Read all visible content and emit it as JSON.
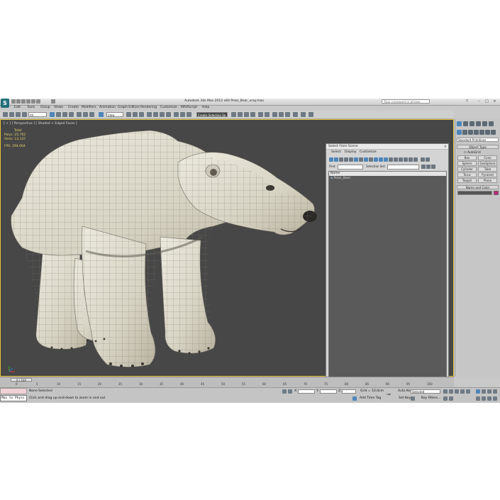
{
  "window": {
    "title": "Autodesk 3ds Max 2012 x64     Polar_Bear_vray.max",
    "search_placeholder": "Type a keyword or phrase",
    "logo_letter": "S"
  },
  "menubar": [
    "Edit",
    "Tools",
    "Group",
    "Views",
    "Create",
    "Modifiers",
    "Animation",
    "Graph Editors",
    "Rendering",
    "Customize",
    "MAXScript",
    "Help"
  ],
  "toolbar": {
    "filter_value": "All",
    "view_value": "View",
    "selection_set_placeholder": "Create Selection Se",
    "accent_color": "#4f86b9"
  },
  "viewport": {
    "label": "[ + ] [ Perspective ] [ Shaded + Edged Faces ]",
    "stats": {
      "header": "Total",
      "polys_label": "Polys:",
      "polys_value": "25,762",
      "verts_label": "Verts:",
      "verts_value": "13,137",
      "fps_label": "FPS:",
      "fps_value": "294.064"
    },
    "border_color": "#e2c437",
    "background": "#474747"
  },
  "select_dialog": {
    "title": "Select From Scene",
    "tabs": [
      "Select",
      "Display",
      "Customize"
    ],
    "find_label": "Find:",
    "selection_set_label": "Selection Set:",
    "column_header": "Name",
    "items": [
      "Polar_Bear"
    ],
    "ok_label": "OK",
    "cancel_label": "Cancel"
  },
  "command_panel": {
    "category": "Standard Primitives",
    "object_type_title": "Object Type",
    "autogrid_label": "AutoGrid",
    "primitives": [
      "Box",
      "Cone",
      "Sphere",
      "GeoSphere",
      "Cylinder",
      "Tube",
      "Torus",
      "Pyramid",
      "Teapot",
      "Plane"
    ],
    "name_color_title": "Name and Color",
    "object_color": "#c8237c"
  },
  "timeline": {
    "frame_counter": "0 / 100",
    "tick_labels": [
      "0",
      "5",
      "10",
      "15",
      "20",
      "25",
      "30",
      "35",
      "40",
      "45",
      "50",
      "55",
      "60",
      "65",
      "70",
      "75",
      "80",
      "85",
      "90",
      "95",
      "100"
    ]
  },
  "statusbar": {
    "maxscript_text": "Max to Physc",
    "selection_status": "None Selected",
    "prompt": "Click and drag up-and-down to zoom in and out",
    "x_label": "X:",
    "y_label": "Y:",
    "z_label": "Z:",
    "grid_label": "Grid = 10,0cm",
    "add_time_tag": "Add Time Tag",
    "auto_key": "Auto Key",
    "set_key": "Set Key",
    "selected_value": "Selected",
    "key_filters": "Key Filters..."
  }
}
